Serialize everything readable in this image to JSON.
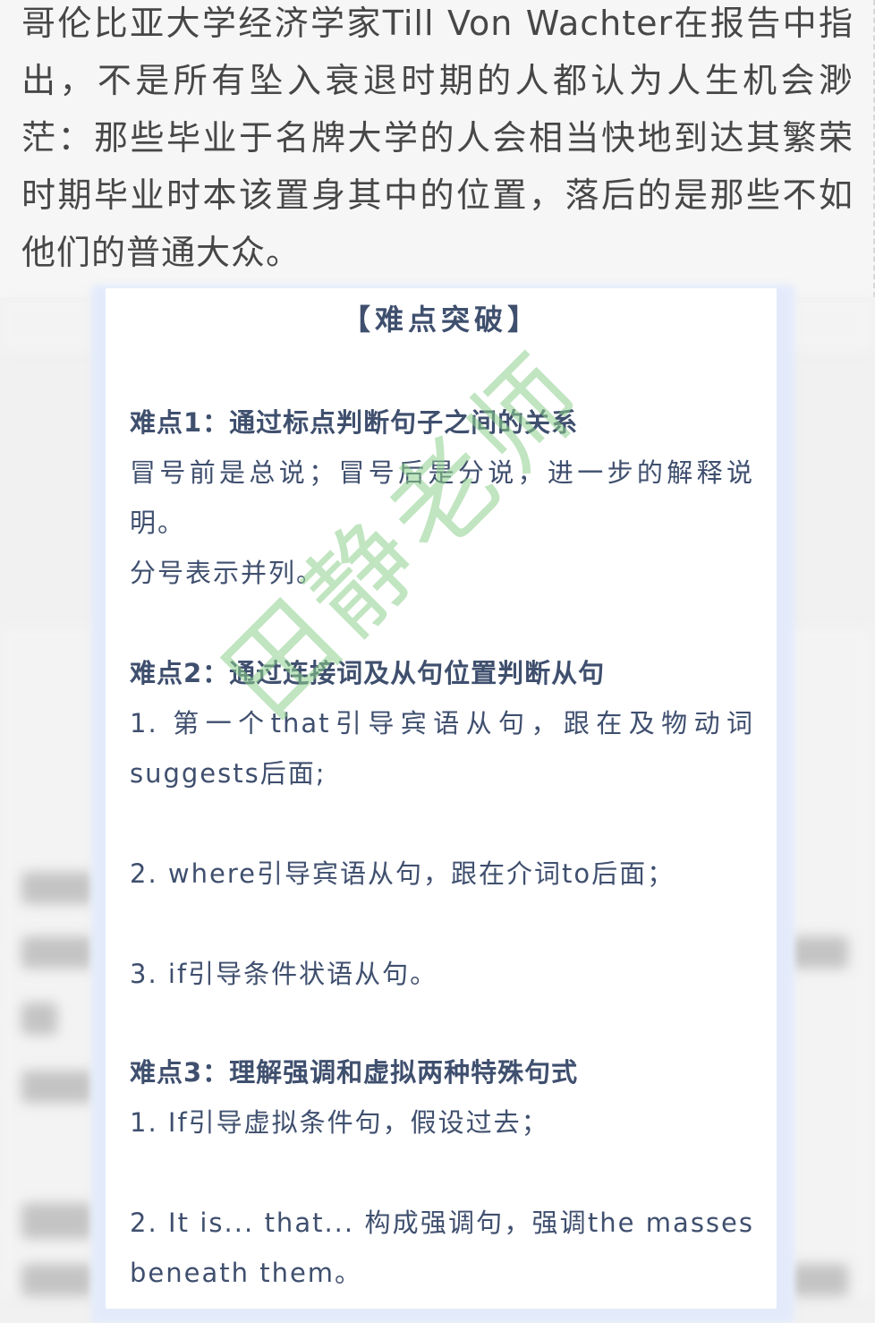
{
  "top_passage": {
    "text": "哥伦比亚大学经济学家Till Von Wachter在报告中指出，不是所有坠入衰退时期的人都认为人生机会渺茫：那些毕业于名牌大学的人会相当快地到达其繁荣时期毕业时本该置身其中的位置，落后的是那些不如他们的普通大众。"
  },
  "card": {
    "title": "【难点突破】",
    "sections": [
      {
        "heading": "难点1：通过标点判断句子之间的关系",
        "lines": [
          "冒号前是总说；冒号后是分说，进一步的解释说",
          "明。",
          "分号表示并列。"
        ]
      },
      {
        "heading": "难点2：通过连接词及从句位置判断从句",
        "lines": [
          "1. 第一个that引导宾语从句，跟在及物动词",
          "suggests后面;",
          "2. where引导宾语从句，跟在介词to后面；",
          "3. if引导条件状语从句。"
        ]
      },
      {
        "heading": "难点3：理解强调和虚拟两种特殊句式",
        "lines": [
          "1. If引导虚拟条件句，假设过去；",
          "2. It is... that... 构成强调句，强调the masses",
          "beneath them。"
        ]
      }
    ]
  },
  "watermark": {
    "text": "田静老师",
    "color": "#8ed18e"
  }
}
